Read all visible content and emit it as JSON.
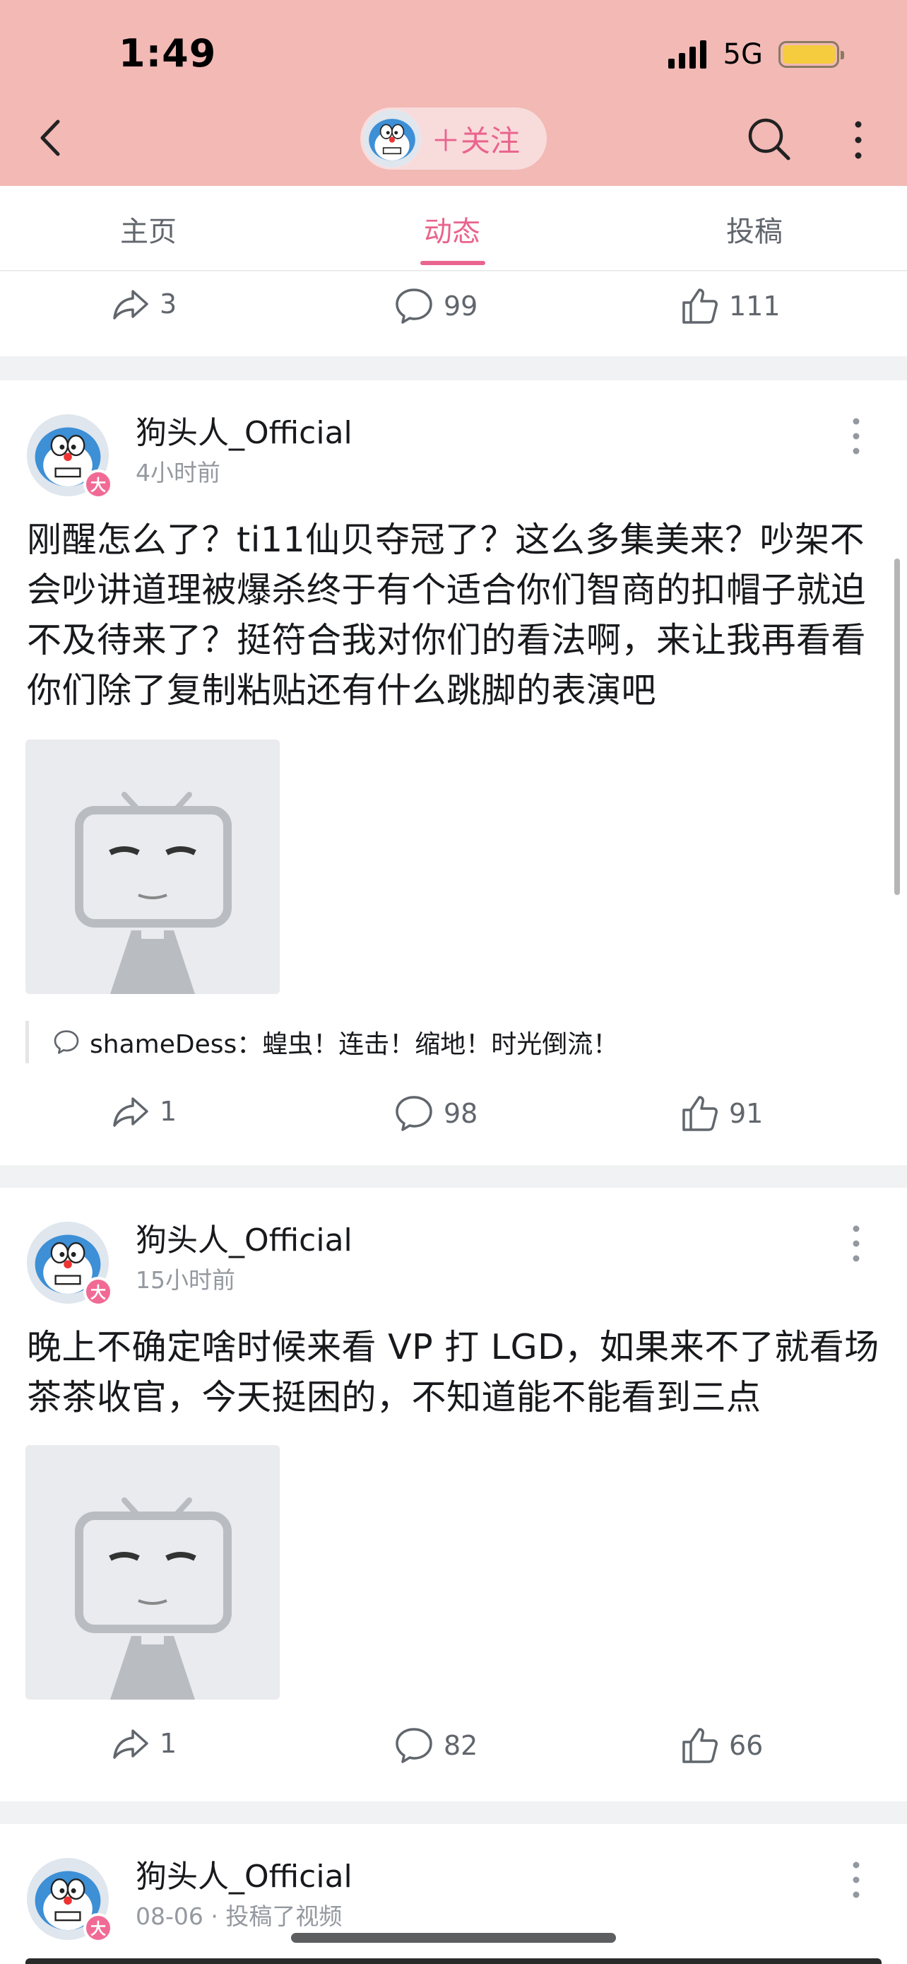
{
  "status_bar": {
    "time": "1:49",
    "network": "5G"
  },
  "header": {
    "follow_label": "＋关注"
  },
  "tabs": [
    {
      "label": "主页"
    },
    {
      "label": "动态"
    },
    {
      "label": "投稿"
    }
  ],
  "top_card": {
    "forward": "3",
    "comments": "99",
    "likes": "111"
  },
  "posts": [
    {
      "username": "狗头人_Official",
      "badge": "大",
      "time": "4小时前",
      "text": "刚醒怎么了？ti11仙贝夺冠了？这么多集美来？吵架不会吵讲道理被爆杀终于有个适合你们智商的扣帽子就迫不及待来了？挺符合我对你们的看法啊，来让我再看看你们除了复制粘贴还有什么跳脚的表演吧",
      "comment_preview": "shameDess：蝗虫！连击！缩地！时光倒流！",
      "forward": "1",
      "comments": "98",
      "likes": "91"
    },
    {
      "username": "狗头人_Official",
      "badge": "大",
      "time": "15小时前",
      "text": "晚上不确定啥时候来看 VP 打 LGD，如果来不了就看场茶茶收官，今天挺困的，不知道能不能看到三点",
      "forward": "1",
      "comments": "82",
      "likes": "66"
    },
    {
      "username": "狗头人_Official",
      "badge": "大",
      "time": "08-06 · 投稿了视频"
    }
  ]
}
